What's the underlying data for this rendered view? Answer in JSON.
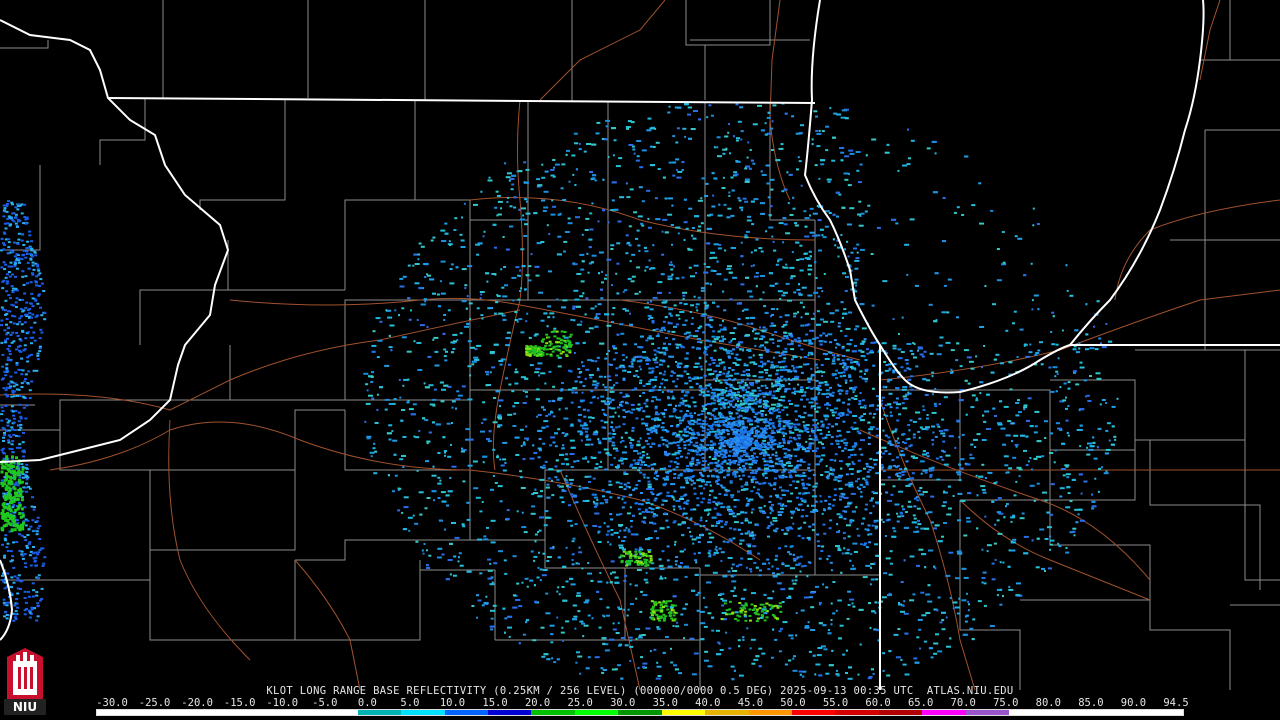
{
  "product": {
    "caption": "KLOT LONG RANGE BASE REFLECTIVITY (0.25KM / 256 LEVEL) (000000/0000 0.5 DEG) 2025-09-13 00:35 UTC  ATLAS.NIU.EDU"
  },
  "logo": {
    "text": "NIU",
    "icon": "niu-logo-icon",
    "colors": {
      "shield": "#c8102e",
      "tower": "#ffffff",
      "base": "#222222"
    }
  },
  "scale": {
    "labels": [
      "-30.0",
      "-25.0",
      "-20.0",
      "-15.0",
      "-10.0",
      "-5.0",
      "0.0",
      "5.0",
      "10.0",
      "15.0",
      "20.0",
      "25.0",
      "30.0",
      "35.0",
      "40.0",
      "45.0",
      "50.0",
      "55.0",
      "60.0",
      "65.0",
      "70.0",
      "75.0",
      "80.0",
      "85.0",
      "90.0",
      "94.5"
    ],
    "colors": [
      "#ffffff",
      "#ffffff",
      "#ffffff",
      "#ffffff",
      "#ffffff",
      "#ffffff",
      "#00b3b3",
      "#00e0ff",
      "#0064ff",
      "#0000d0",
      "#00c000",
      "#00ff00",
      "#009600",
      "#ffff00",
      "#e6b400",
      "#ff9600",
      "#ff0000",
      "#d40000",
      "#b00000",
      "#ff00ff",
      "#9955c9",
      "#ffffff",
      "#ffffff",
      "#ffffff",
      "#ffffff"
    ]
  },
  "map_colors": {
    "state_line": "#ffffff",
    "county_line": "#8c8c8c",
    "highway": "#a0522d",
    "background": "#000000"
  }
}
